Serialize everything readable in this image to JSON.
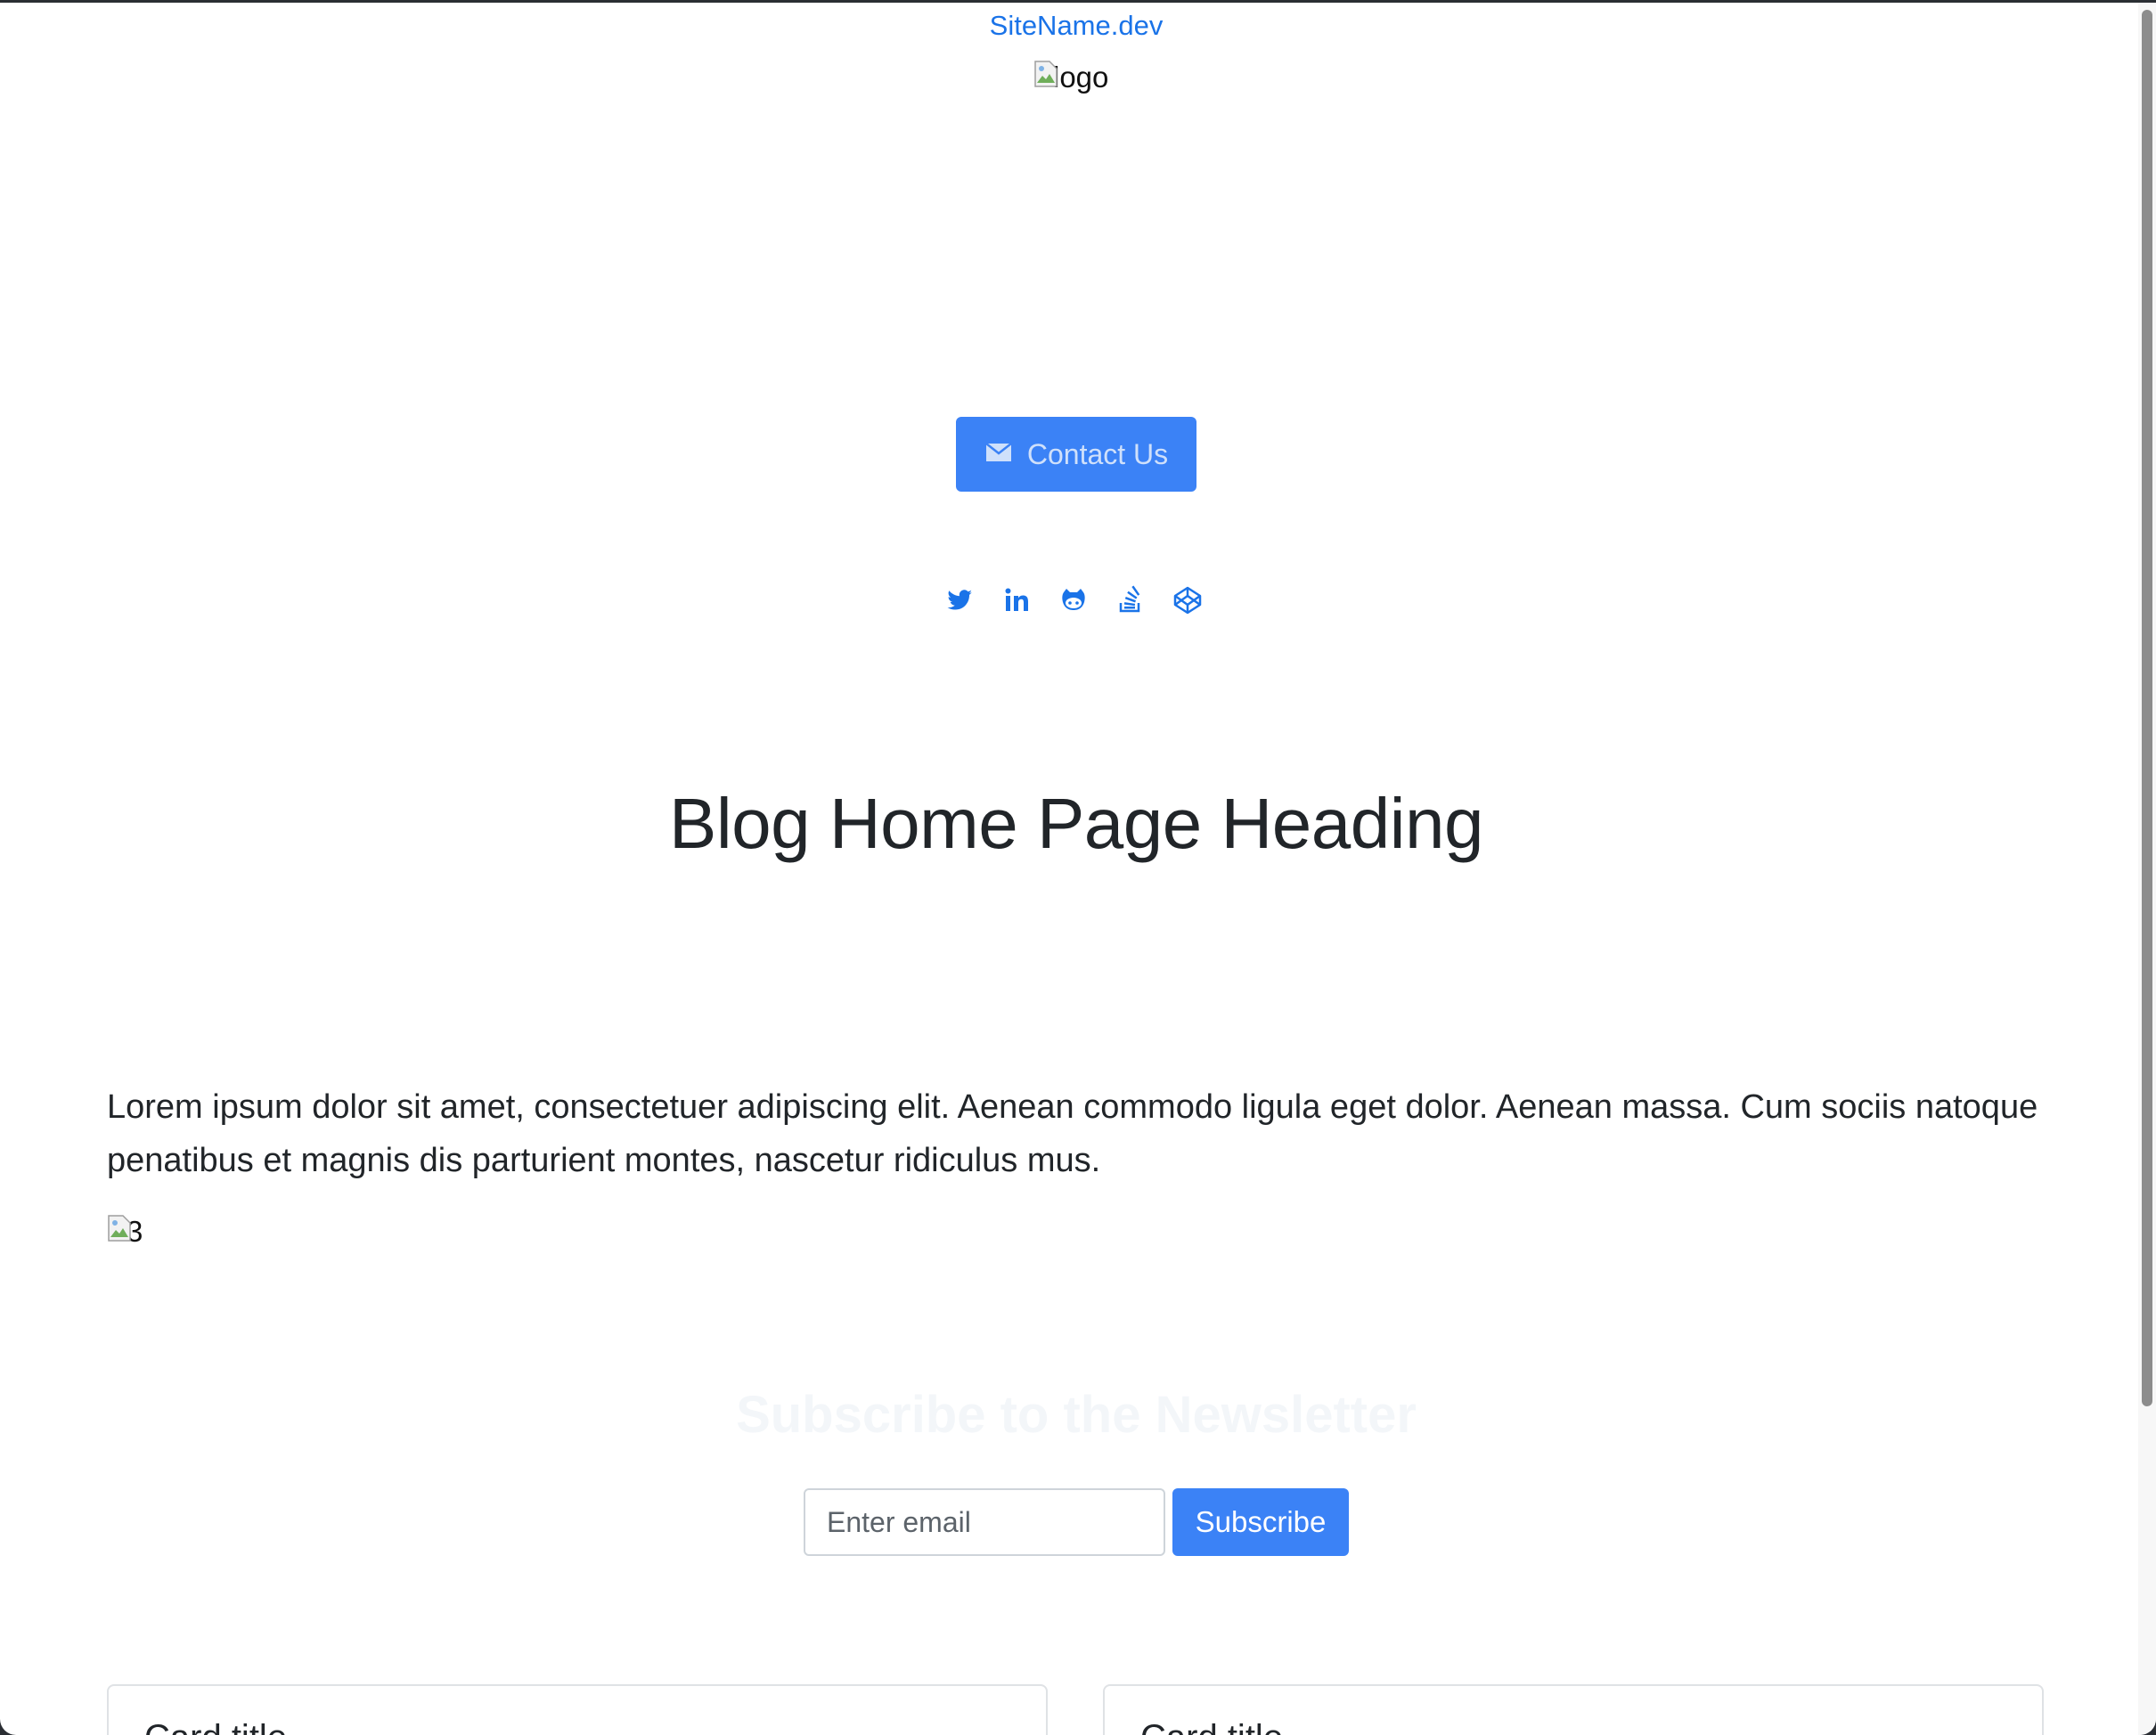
{
  "header": {
    "site_name": "SiteName.dev",
    "logo_alt": "logo"
  },
  "hero": {
    "contact_button_label": "Contact Us",
    "social_links": [
      "twitter-icon",
      "linkedin-icon",
      "github-icon",
      "stackoverflow-icon",
      "codepen-icon"
    ]
  },
  "main": {
    "heading": "Blog Home Page Heading",
    "intro": "Lorem ipsum dolor sit amet, consectetuer adipiscing elit. Aenean commodo ligula eget dolor. Aenean massa. Cum sociis natoque penatibus et magnis dis parturient montes, nascetur ridiculus mus.",
    "image_alt": "3"
  },
  "newsletter": {
    "title": "Subscribe to the Newsletter",
    "email_placeholder": "Enter email",
    "subscribe_label": "Subscribe"
  },
  "cards": [
    {
      "title": "Card title"
    },
    {
      "title": "Card title"
    }
  ],
  "colors": {
    "accent": "#3b82f6",
    "link": "#1a73e8",
    "text": "#212529"
  }
}
